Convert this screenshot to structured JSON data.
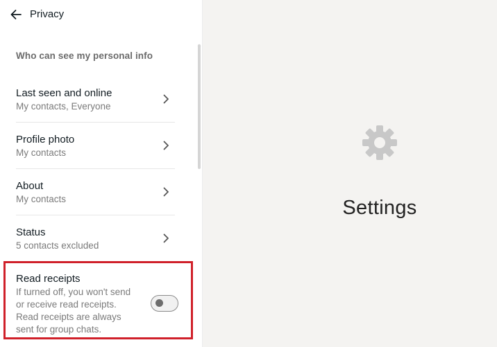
{
  "header": {
    "title": "Privacy"
  },
  "section": {
    "title": "Who can see my personal info"
  },
  "items": [
    {
      "label": "Last seen and online",
      "value": "My contacts, Everyone"
    },
    {
      "label": "Profile photo",
      "value": "My contacts"
    },
    {
      "label": "About",
      "value": "My contacts"
    },
    {
      "label": "Status",
      "value": "5 contacts excluded"
    }
  ],
  "read_receipts": {
    "label": "Read receipts",
    "description_lines": [
      "If turned off, you won't send",
      "or receive read receipts.",
      "Read receipts are always",
      "sent for group chats."
    ],
    "enabled": false
  },
  "right_pane": {
    "label": "Settings",
    "icon": "gear-icon"
  },
  "colors": {
    "highlight": "#d0202a",
    "right_background": "#f4f3f1",
    "gear": "#c8c8c8"
  }
}
